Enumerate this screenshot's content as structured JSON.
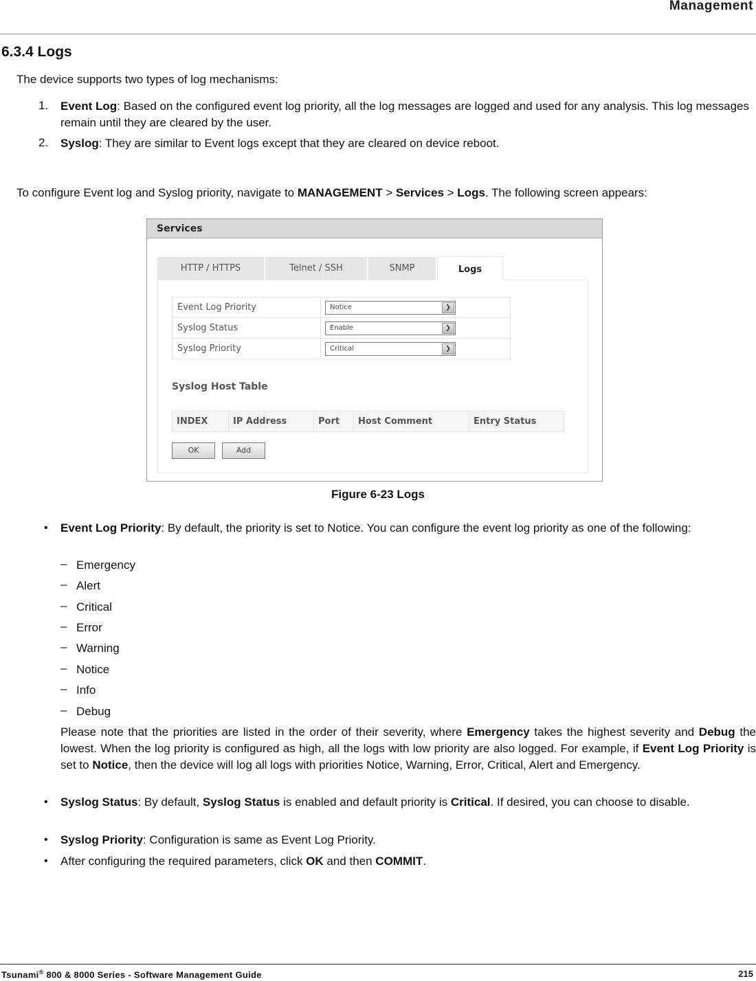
{
  "header": {
    "title": "Management"
  },
  "section": {
    "title": "6.3.4 Logs"
  },
  "intro": "The device supports two types of log mechanisms:",
  "mechanisms": [
    {
      "num": "1.",
      "term": "Event Log",
      "text": ": Based on the configured event log priority, all the log messages are logged and used for any analysis. This log messages remain until they are cleared by the user."
    },
    {
      "num": "2.",
      "term": "Syslog",
      "text": ": They are similar to Event logs except that they are cleared on device reboot."
    }
  ],
  "navigate": {
    "prefix": "To configure Event log and Syslog priority, navigate to ",
    "path1": "MANAGEMENT",
    "sep1": " > ",
    "path2": "Services",
    "sep2": " > ",
    "path3": "Logs",
    "suffix": ". The following screen appears:"
  },
  "figure": {
    "panel_title": "Services",
    "tabs": [
      {
        "label": "HTTP / HTTPS",
        "active": false
      },
      {
        "label": "Telnet / SSH",
        "active": false
      },
      {
        "label": "SNMP",
        "active": false
      },
      {
        "label": "Logs",
        "active": true
      }
    ],
    "fields": [
      {
        "label": "Event Log Priority",
        "value": "Notice"
      },
      {
        "label": "Syslog Status",
        "value": "Enable"
      },
      {
        "label": "Syslog Priority",
        "value": "Critical"
      }
    ],
    "host_table_title": "Syslog Host Table",
    "host_columns": [
      "INDEX",
      "IP Address",
      "Port",
      "Host Comment",
      "Entry Status"
    ],
    "ok_label": "OK",
    "add_label": "Add",
    "dropdown_arrow": "chevron-down-icon"
  },
  "caption": "Figure 6-23 Logs",
  "bullets": {
    "event_log": {
      "term": "Event Log Priority",
      "text": ": By default, the priority is set to Notice. You can configure the event log priority as one of the following:"
    },
    "priorities": [
      "Emergency",
      "Alert",
      "Critical",
      "Error",
      "Warning",
      "Notice",
      "Info",
      "Debug"
    ],
    "note": {
      "t1": "Please note that the priorities are listed in the order of their severity, where ",
      "b1": "Emergency",
      "t2": " takes the highest severity and ",
      "b2": "Debug",
      "t3": " the lowest. When the log priority is configured as high, all the logs with low priority are also logged. For example, if ",
      "b3": "Event Log Priority",
      "t4": " is set to ",
      "b4": "Notice",
      "t5": ", then the device will log all logs with priorities Notice, Warning, Error, Critical, Alert and Emergency."
    },
    "syslog_status": {
      "b1": "Syslog Status",
      "t1": ": By default, ",
      "b2": "Syslog Status",
      "t2": " is enabled and default priority is ",
      "b3": "Critical",
      "t3": ". If desired, you can choose to disable."
    },
    "syslog_priority": {
      "term": "Syslog Priority",
      "text": ": Configuration is same as Event Log Priority."
    },
    "after": {
      "t1": "After configuring the required parameters, click ",
      "b1": "OK",
      "t2": " and then ",
      "b2": "COMMIT",
      "t3": "."
    },
    "bullet_glyph": "•",
    "dash_glyph": "–"
  },
  "footer": {
    "brand": "Tsunami",
    "reg": "®",
    "rest": " 800 & 8000 Series - Software Management Guide",
    "page": "215"
  }
}
